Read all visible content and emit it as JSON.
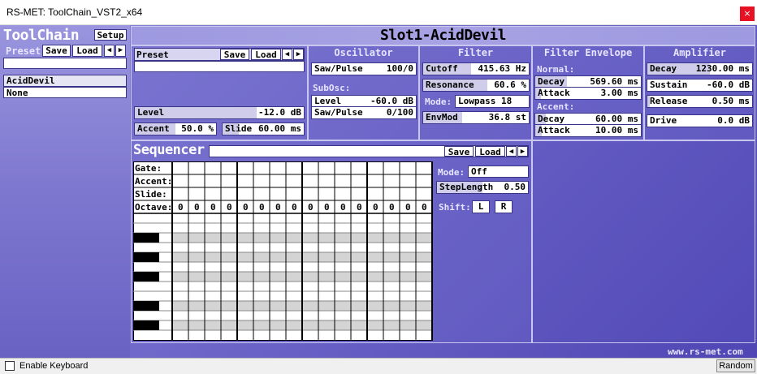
{
  "window": {
    "title": "RS-MET: ToolChain_VST2_x64",
    "close_glyph": "×"
  },
  "toolchain": {
    "logo": "ToolChain",
    "setup": "Setup",
    "preset_label": "Preset",
    "save": "Save",
    "load": "Load",
    "prev": "◀",
    "next": "▶",
    "slots": [
      "AcidDevil",
      "None"
    ]
  },
  "slot_title": "Slot1-AcidDevil",
  "preset_bar": {
    "label": "Preset",
    "save": "Save",
    "load": "Load",
    "prev": "◀",
    "next": "▶"
  },
  "global": {
    "level": {
      "label": "Level",
      "value": "-12.0 dB"
    },
    "accent": {
      "label": "Accent",
      "value": "50.0 %"
    },
    "slide": {
      "label": "Slide",
      "value": "60.00 ms"
    }
  },
  "oscillator": {
    "title": "Oscillator",
    "saw_pulse": {
      "label": "Saw/Pulse",
      "value": "100/0"
    },
    "subosc_label": "SubOsc:",
    "sub_level": {
      "label": "Level",
      "value": "-60.0 dB"
    },
    "sub_saw_pulse": {
      "label": "Saw/Pulse",
      "value": "0/100"
    }
  },
  "filter": {
    "title": "Filter",
    "cutoff": {
      "label": "Cutoff",
      "value": "415.63 Hz",
      "fill": 0.45
    },
    "resonance": {
      "label": "Resonance",
      "value": "60.6 %",
      "fill": 0.606
    },
    "mode": {
      "label": "Mode:",
      "value": "Lowpass 18"
    },
    "envmod": {
      "label": "EnvMod",
      "value": "36.8 st",
      "fill": 0.37
    }
  },
  "filter_env": {
    "title": "Filter Envelope",
    "normal_label": "Normal:",
    "n_decay": {
      "label": "Decay",
      "value": "569.60 ms",
      "fill": 0.3
    },
    "n_attack": {
      "label": "Attack",
      "value": "3.00 ms",
      "fill": 0.05
    },
    "accent_label": "Accent:",
    "a_decay": {
      "label": "Decay",
      "value": "60.00 ms",
      "fill": 0.1
    },
    "a_attack": {
      "label": "Attack",
      "value": "10.00 ms",
      "fill": 0.06
    }
  },
  "amplifier": {
    "title": "Amplifier",
    "decay": {
      "label": "Decay",
      "value": "1230.00 ms",
      "fill": 0.6
    },
    "sustain": {
      "label": "Sustain",
      "value": "-60.0 dB",
      "fill": 0.0
    },
    "release": {
      "label": "Release",
      "value": "0.50 ms",
      "fill": 0.02
    },
    "drive": {
      "label": "Drive",
      "value": "0.0 dB",
      "fill": 0.0
    }
  },
  "sequencer": {
    "logo": "Sequencer",
    "save": "Save",
    "load": "Load",
    "prev": "◀",
    "next": "▶",
    "row_labels": [
      "Gate:",
      "Accent:",
      "Slide:",
      "Octave:"
    ],
    "octaves": [
      "0",
      "0",
      "0",
      "0",
      "0",
      "0",
      "0",
      "0",
      "0",
      "0",
      "0",
      "0",
      "0",
      "0",
      "0",
      "0"
    ],
    "mode": {
      "label": "Mode:",
      "value": "Off"
    },
    "steplength": {
      "label": "StepLength",
      "value": "0.50"
    },
    "shift": {
      "label": "Shift:",
      "left": "L",
      "right": "R"
    }
  },
  "website": "www.rs-met.com",
  "footer": {
    "enable_keyboard": "Enable Keyboard",
    "random": "Random"
  },
  "colors": {
    "background": "#6f67c9",
    "field": "#ffffff",
    "border": "#3a3488",
    "close": "#e81123"
  }
}
